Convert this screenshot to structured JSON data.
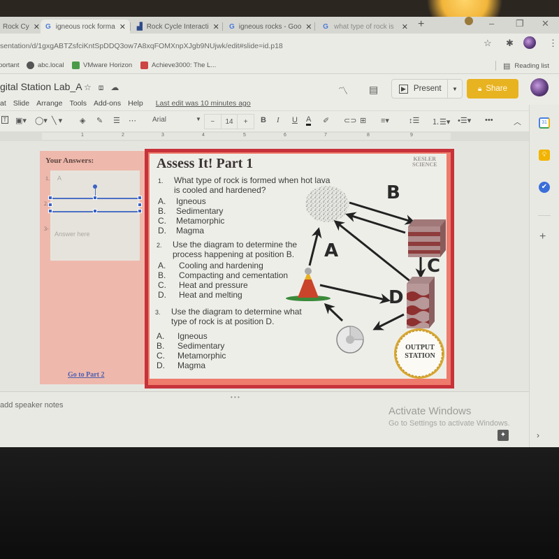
{
  "browser": {
    "tabs": [
      {
        "label": "Rock Cy",
        "icon": "slides-icon",
        "active": false
      },
      {
        "label": "igneous rock forma",
        "icon": "google-icon",
        "active": true
      },
      {
        "label": "Rock Cycle Interacti",
        "icon": "site-icon",
        "active": false
      },
      {
        "label": "igneous rocks - Goo",
        "icon": "google-icon",
        "active": false
      },
      {
        "label": "what type of rock is",
        "icon": "google-icon",
        "active": false
      }
    ],
    "new_tab": "+",
    "url": "sentation/d/1gxgABTZsfciKntSpDDQ3ow7A8xqFOMXnpXJgb9NUjwk/edit#slide=id.p18",
    "bookmarks": [
      {
        "label": "portant"
      },
      {
        "label": "abc.local"
      },
      {
        "label": "VMware Horizon"
      },
      {
        "label": "Achieve3000: The L..."
      }
    ],
    "reading_list": "Reading list"
  },
  "doc": {
    "title": "gital Station Lab_A",
    "menu": [
      "at",
      "Slide",
      "Arrange",
      "Tools",
      "Add-ons",
      "Help"
    ],
    "last_edit": "Last edit was 10 minutes ago",
    "present_label": "Present",
    "share_label": "Share"
  },
  "toolbar": {
    "font": "Arial",
    "font_size": "14",
    "decrease": "−",
    "increase": "+",
    "bold": "B",
    "italic": "I",
    "underline": "U",
    "text_color": "A",
    "more": "•••"
  },
  "ruler": {
    "marks": [
      "1",
      "2",
      "3",
      "4",
      "5",
      "6",
      "7",
      "8",
      "9"
    ]
  },
  "slide": {
    "left_panel": {
      "heading": "Your Answers:",
      "answers": [
        {
          "num": "1.",
          "value": "A"
        },
        {
          "num": "2.",
          "value": ""
        },
        {
          "num": "3-",
          "value": "",
          "placeholder": "Answer here"
        }
      ],
      "link": "Go to Part 2"
    },
    "title": "Assess It!  Part 1",
    "brand": [
      "KESLER",
      "SCIENCE"
    ],
    "questions": [
      {
        "num": "1.",
        "text": "What type of rock is formed when hot lava is cooled and hardened?",
        "options": [
          {
            "letter": "A.",
            "text": "Igneous"
          },
          {
            "letter": "B.",
            "text": "Sedimentary"
          },
          {
            "letter": "C.",
            "text": "Metamorphic"
          },
          {
            "letter": "D.",
            "text": "Magma"
          }
        ]
      },
      {
        "num": "2.",
        "text": "Use the diagram to determine the process happening at position B.",
        "options": [
          {
            "letter": "A.",
            "text": "Cooling and hardening"
          },
          {
            "letter": "B.",
            "text": "Compacting and cementation"
          },
          {
            "letter": "C.",
            "text": "Heat and pressure"
          },
          {
            "letter": "D.",
            "text": "Heat and melting"
          }
        ]
      },
      {
        "num": "3.",
        "text": "Use the diagram to determine what type of rock is at position D.",
        "options": [
          {
            "letter": "A.",
            "text": "Igneous"
          },
          {
            "letter": "B.",
            "text": "Sedimentary"
          },
          {
            "letter": "C.",
            "text": "Metamorphic"
          },
          {
            "letter": "D.",
            "text": "Magma"
          }
        ]
      }
    ],
    "diagram_labels": {
      "a": "A",
      "b": "B",
      "c": "C",
      "d": "D"
    },
    "output_station": [
      "OUTPUT",
      "STATION"
    ]
  },
  "notes": {
    "placeholder": "add speaker notes"
  },
  "watermark": {
    "title": "Activate Windows",
    "subtitle": "Go to Settings to activate Windows."
  },
  "colors": {
    "share": "#e8b321",
    "slide_border": "#c7323a",
    "slide_frame": "#ee7b6c",
    "answer_panel": "#efb8ac",
    "selection": "#3a63c4"
  }
}
